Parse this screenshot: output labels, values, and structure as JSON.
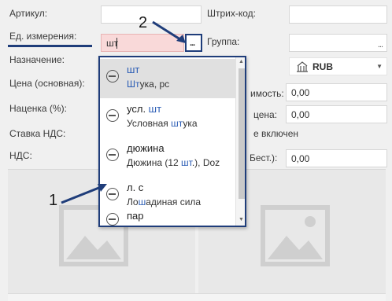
{
  "form": {
    "article_label": "Артикул:",
    "unit_label": "Ед. измерения:",
    "unit_value": "шт",
    "purpose_label": "Назначение:",
    "price_label": "Цена (основная):",
    "markup_label": "Наценка (%):",
    "vat_rate_label": "Ставка НДС:",
    "vat_label": "НДС:",
    "barcode_label": "Штрих-код:",
    "group_label": "Группа:",
    "currency_value": "RUB",
    "cost_label_partial": "имость:",
    "cost_value": "0,00",
    "price2_label_partial": "цена:",
    "price2_value": "0,00",
    "vat_included_partial": "е включен",
    "best_label_partial": "Бест.):",
    "best_value": "0,00",
    "browse_dots": "..."
  },
  "dropdown": {
    "items": [
      {
        "main_hl": "шт",
        "main_rest": "",
        "sub_pre": "",
        "sub_hl": "Шт",
        "sub_post": "ука, pc"
      },
      {
        "main_hl": "",
        "main_rest": "усл. ",
        "main_hl2": "шт",
        "sub_pre": "Условная ",
        "sub_hl": "шт",
        "sub_post": "ука"
      },
      {
        "main_hl": "",
        "main_rest": "дюжина",
        "sub_pre": "Дюжина (12 ",
        "sub_hl": "шт",
        "sub_post": ".), Doz"
      },
      {
        "main_hl": "",
        "main_rest": "л. с",
        "sub_pre": "Ло",
        "sub_hl": "ш",
        "sub_post": "адиная сила"
      },
      {
        "main_hl": "",
        "main_rest": "пар",
        "sub_pre": "",
        "sub_hl": "",
        "sub_post": ""
      }
    ]
  },
  "annotations": {
    "marker_1": "1",
    "marker_2": "2"
  },
  "colors": {
    "accent": "#1f3d7a",
    "highlight": "#2b5db5",
    "active_field": "#f9d9d9"
  }
}
